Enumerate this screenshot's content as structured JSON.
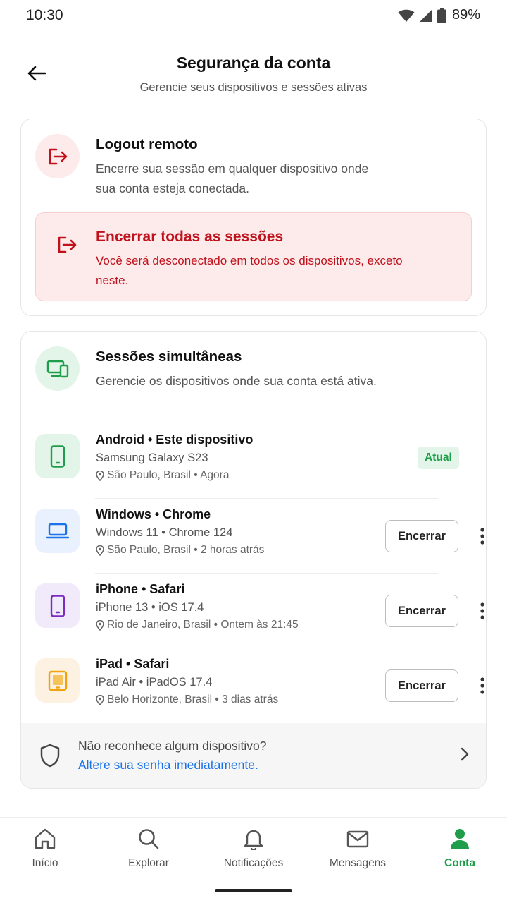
{
  "status_bar": {
    "time": "10:30",
    "battery": "89%"
  },
  "header": {
    "title": "Segurança da conta",
    "subtitle": "Gerencie seus dispositivos e sessões ativas"
  },
  "logout_card": {
    "title": "Logout remoto",
    "description": "Encerre sua sessão em qualquer dispositivo onde sua conta esteja conectada.",
    "action_title": "Encerrar todas as sessões",
    "action_description": "Você será desconectado em todos os dispositivos, exceto neste."
  },
  "sessions_card": {
    "title": "Sessões simultâneas",
    "description": "Gerencie os dispositivos onde sua conta está ativa.",
    "devices": [
      {
        "name": "Android • Este dispositivo",
        "model": "Samsung Galaxy S23",
        "location": "São Paulo, Brasil • Agora",
        "badge": "Atual",
        "icon": "smartphone-icon",
        "color": "#1f9d4a"
      },
      {
        "name": "Windows • Chrome",
        "model": "Windows 11 • Chrome 124",
        "location": "São Paulo, Brasil • 2 horas atrás",
        "action": "Encerrar",
        "icon": "laptop-icon",
        "color": "#1a73e8"
      },
      {
        "name": "iPhone • Safari",
        "model": "iPhone 13 • iOS 17.4",
        "location": "Rio de Janeiro, Brasil • Ontem às 21:45",
        "action": "Encerrar",
        "icon": "smartphone-icon",
        "color": "#7b2cbf"
      },
      {
        "name": "iPad • Safari",
        "model": "iPad Air • iPadOS 17.4",
        "location": "Belo Horizonte, Brasil • 3 dias atrás",
        "action": "Encerrar",
        "icon": "tablet-icon",
        "color": "#f2a20c"
      }
    ],
    "notice_question": "Não reconhece algum dispositivo?",
    "notice_link": "Altere sua senha imediatamente."
  },
  "bottom_nav": {
    "items": [
      {
        "label": "Início",
        "icon": "home-icon"
      },
      {
        "label": "Explorar",
        "icon": "search-icon"
      },
      {
        "label": "Notificações",
        "icon": "bell-icon"
      },
      {
        "label": "Mensagens",
        "icon": "mail-icon"
      },
      {
        "label": "Conta",
        "icon": "person-icon",
        "active": true
      }
    ]
  },
  "colors": {
    "danger": "#c0121c",
    "danger_bg": "#fdebeb",
    "success": "#1f9d4a",
    "link": "#1a73e8"
  }
}
